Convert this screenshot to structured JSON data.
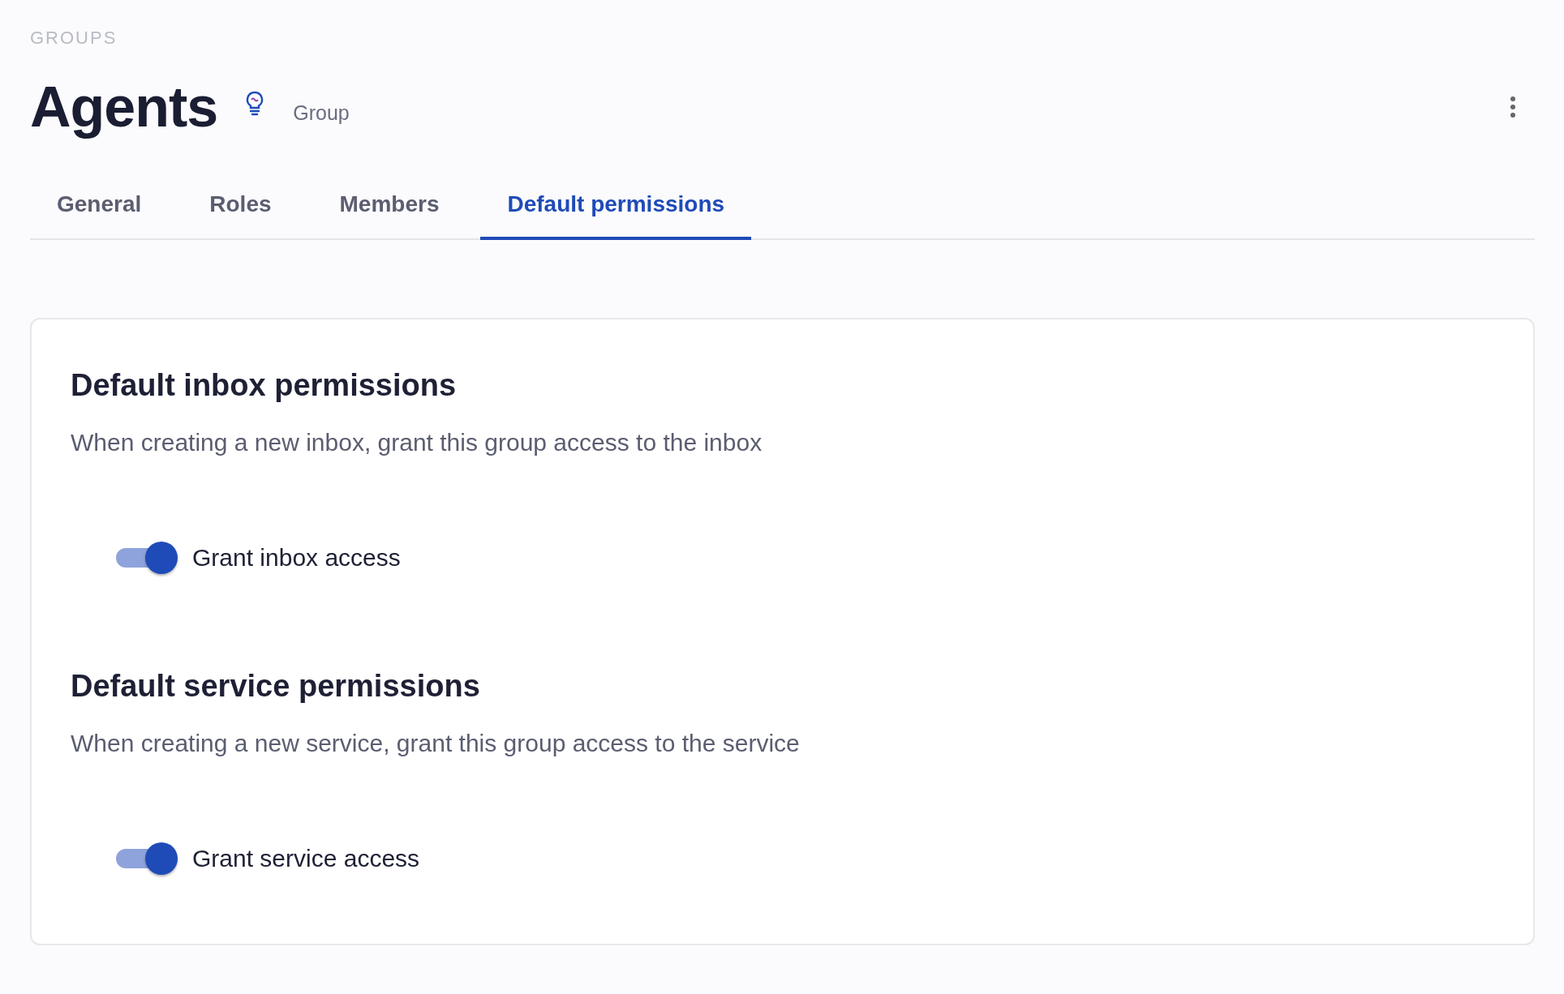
{
  "breadcrumb": "GROUPS",
  "header": {
    "title": "Agents",
    "subtitle": "Group"
  },
  "tabs": [
    {
      "label": "General",
      "selected": false
    },
    {
      "label": "Roles",
      "selected": false
    },
    {
      "label": "Members",
      "selected": false
    },
    {
      "label": "Default permissions",
      "selected": true
    }
  ],
  "sections": [
    {
      "heading": "Default inbox permissions",
      "description": "When creating a new inbox, grant this group access to the inbox",
      "toggle": {
        "label": "Grant inbox access",
        "on": true
      }
    },
    {
      "heading": "Default service permissions",
      "description": "When creating a new service, grant this group access to the service",
      "toggle": {
        "label": "Grant service access",
        "on": true
      }
    }
  ]
}
